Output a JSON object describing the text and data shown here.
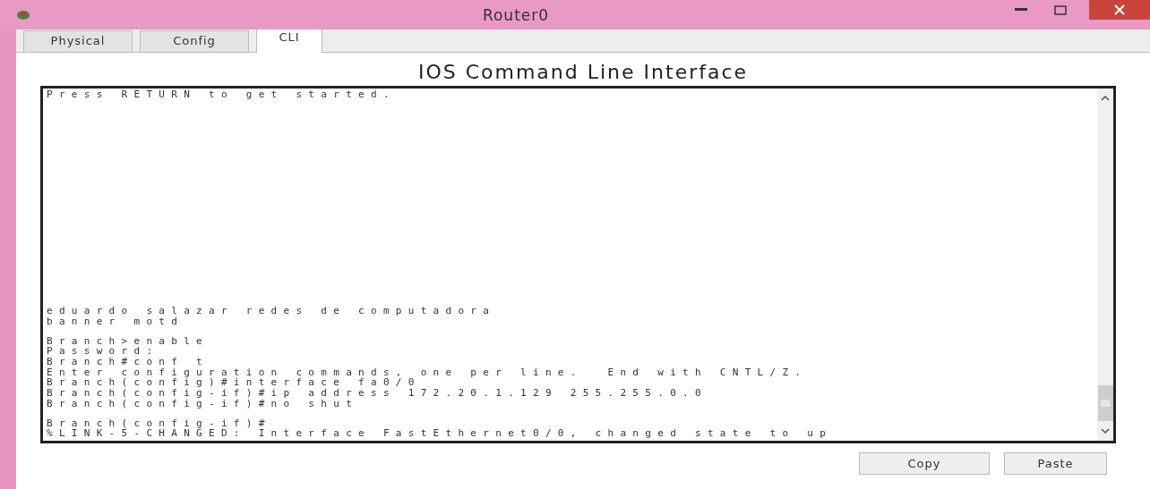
{
  "window": {
    "title": "Router0"
  },
  "tabs": [
    {
      "label": "Physical",
      "selected": false
    },
    {
      "label": "Config",
      "selected": false
    },
    {
      "label": "CLI",
      "selected": true
    }
  ],
  "heading": "IOS Command Line Interface",
  "terminal": {
    "blocks": [
      [
        "Press RETURN to get started."
      ],
      [
        "eduardo salazar redes de computadora",
        "banner motd"
      ],
      [
        "Branch>enable",
        "Password:",
        "Branch#conf t",
        "Enter configuration commands, one per line.  End with CNTL/Z.",
        "Branch(config)#interface fa0/0",
        "Branch(config-if)#ip address 172.20.1.129 255.255.0.0",
        "Branch(config-if)#no shut"
      ],
      [
        "Branch(config-if)#",
        "%LINK-5-CHANGED: Interface FastEthernet0/0, changed state to up"
      ]
    ]
  },
  "buttons": [
    "Copy",
    "Paste"
  ]
}
